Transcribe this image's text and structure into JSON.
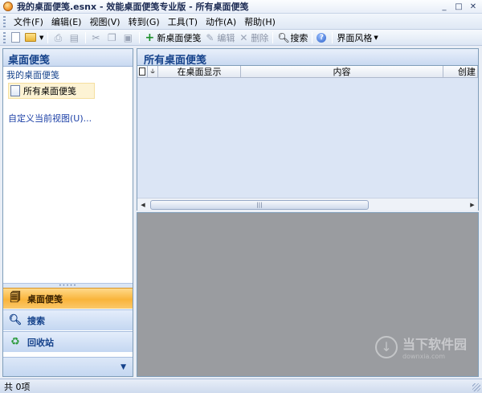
{
  "window": {
    "title": "我的桌面便笺.esnx - 效能桌面便笺专业版 - 所有桌面便笺",
    "app_icon": "app-icon",
    "controls": {
      "minimize": "_",
      "maximize": "□",
      "close": "✕"
    }
  },
  "menu": [
    "文件(F)",
    "编辑(E)",
    "视图(V)",
    "转到(G)",
    "工具(T)",
    "动作(A)",
    "帮助(H)"
  ],
  "toolbar": {
    "new_note": "新桌面便笺",
    "edit": "编辑",
    "delete": "删除",
    "search": "搜索",
    "skin": "界面风格"
  },
  "left_panel": {
    "header": "桌面便笺",
    "group": "我的桌面便笺",
    "selected_item": "所有桌面便笺",
    "customize_link": "自定义当前视图(U)...",
    "nav": [
      {
        "label": "桌面便笺",
        "icon": "notes-icon",
        "active": true
      },
      {
        "label": "搜索",
        "icon": "search-icon",
        "active": false
      },
      {
        "label": "回收站",
        "icon": "recycle-bin-icon",
        "active": false
      }
    ]
  },
  "right_panel": {
    "header": "所有桌面便笺",
    "columns": [
      "在桌面显示",
      "内容",
      "创建"
    ]
  },
  "watermark": {
    "text": "当下软件园",
    "url": "downxia.com"
  },
  "status": {
    "text": "共 0项"
  },
  "colors": {
    "accent": "#15428b",
    "active_nav": "#f9b43b",
    "preview_bg": "#9a9ca0"
  }
}
